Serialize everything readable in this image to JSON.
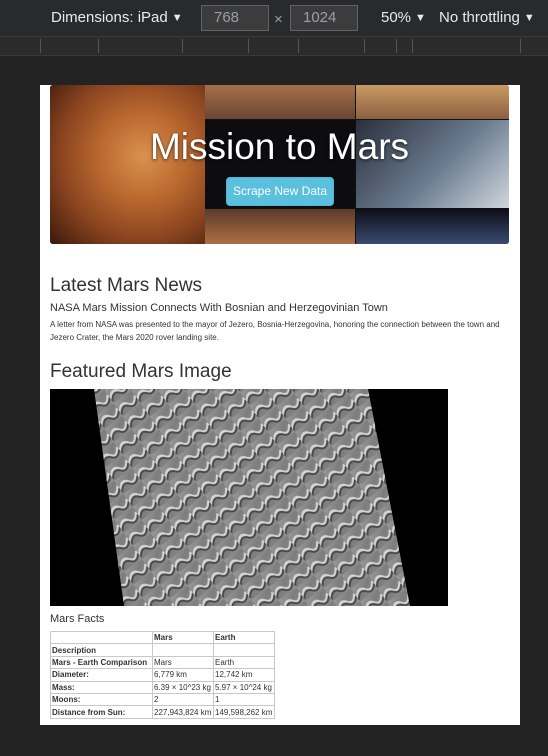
{
  "devtools": {
    "dimensions_label": "Dimensions: iPad",
    "width_value": "768",
    "height_value": "1024",
    "times_symbol": "×",
    "zoom_label": "50%",
    "throttle_label": "No throttling",
    "caret": "▼"
  },
  "page": {
    "jumbotron": {
      "title": "Mission to Mars",
      "button_label": "Scrape New Data",
      "button_color": "#5bc0de"
    },
    "news": {
      "heading": "Latest Mars News",
      "title": "NASA Mars Mission Connects With Bosnian and Herzegovinian Town",
      "body": "A letter from NASA was presented to the mayor of Jezero, Bosnia-Herzegovina, honoring the connection between the town and Jezero Crater, the Mars 2020 rover landing site."
    },
    "featured_image": {
      "heading": "Featured Mars Image"
    },
    "facts": {
      "heading": "Mars Facts",
      "columns": [
        "",
        "Mars",
        "Earth"
      ],
      "rows": [
        [
          "Description",
          "",
          ""
        ],
        [
          "Mars - Earth Comparison",
          "Mars",
          "Earth"
        ],
        [
          "Diameter:",
          "6,779 km",
          "12,742 km"
        ],
        [
          "Mass:",
          "6.39 × 10^23 kg",
          "5.97 × 10^24 kg"
        ],
        [
          "Moons:",
          "2",
          "1"
        ],
        [
          "Distance from Sun:",
          "227,943,824 km",
          "149,598,262 km"
        ]
      ]
    }
  }
}
